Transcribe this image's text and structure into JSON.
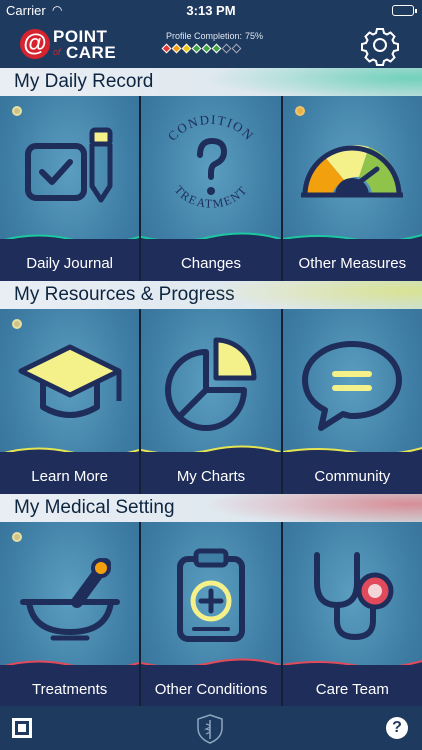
{
  "status_bar": {
    "carrier": "Carrier",
    "time": "3:13 PM"
  },
  "header": {
    "logo_at": "@",
    "logo_point": "POINT",
    "logo_of": "of",
    "logo_care": "CARE",
    "profile_label": "Profile Completion:",
    "profile_value": "75%",
    "profile_fraction": 0.75,
    "diamond_colors": [
      "#e53935",
      "#f39c12",
      "#f1c40f",
      "#43a047",
      "#43a047",
      "#43a047",
      "none",
      "none"
    ]
  },
  "sections": [
    {
      "title": "My Daily Record",
      "tiles": [
        {
          "label": "Daily Journal",
          "icon": "checklist-icon"
        },
        {
          "label": "Changes",
          "icon": "condition-treatment-icon",
          "icon_text_top": "CONDITION",
          "icon_text_bottom": "TREATMENT"
        },
        {
          "label": "Other Measures",
          "icon": "gauge-icon"
        }
      ]
    },
    {
      "title": "My Resources & Progress",
      "tiles": [
        {
          "label": "Learn More",
          "icon": "graduation-cap-icon"
        },
        {
          "label": "My Charts",
          "icon": "pie-chart-icon"
        },
        {
          "label": "Community",
          "icon": "speech-bubble-icon"
        }
      ]
    },
    {
      "title": "My Medical Setting",
      "tiles": [
        {
          "label": "Treatments",
          "icon": "mortar-pestle-icon"
        },
        {
          "label": "Other Conditions",
          "icon": "clipboard-icon"
        },
        {
          "label": "Care Team",
          "icon": "stethoscope-icon"
        }
      ]
    }
  ],
  "colors": {
    "header_bg": "#1f3a5f",
    "tile_bg": "#3f7ea5",
    "label_band": "#1f2d5a",
    "accent_yellow": "#f4f18a",
    "wave_daily": "#1bc8a0",
    "wave_resources": "#e5e552",
    "wave_medical": "#e14a5a"
  },
  "bottom_bar": {
    "help": "?"
  }
}
